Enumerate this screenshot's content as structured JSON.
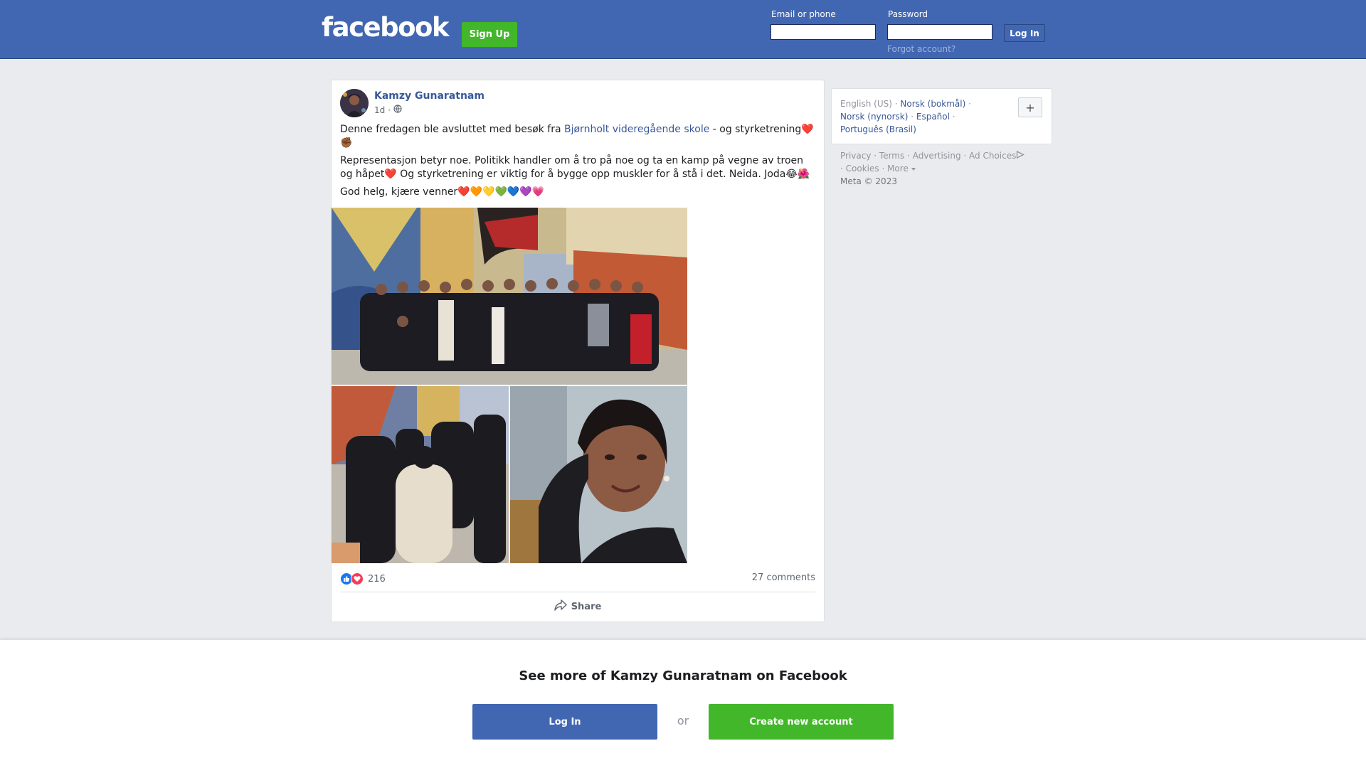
{
  "header": {
    "logo": "facebook",
    "signup_label": "Sign Up",
    "email_label": "Email or phone",
    "password_label": "Password",
    "login_label": "Log In",
    "forgot_label": "Forgot account?"
  },
  "post": {
    "author": "Kamzy Gunaratnam",
    "time": "1d",
    "separator": "·",
    "text": {
      "p1_before": "Denne fredagen ble avsluttet med besøk fra ",
      "p1_link": "Bjørnholt videregående skole",
      "p1_after": " - og styrketrening",
      "p1_emoji": "❤️✊🏾",
      "p2": "Representasjon betyr noe. Politikk handler om å tro på noe og ta en kamp på vegne av troen og håpet❤️ Og styrketrening er viktig for å bygge opp muskler for å stå i det. Neida. Joda😂🌺",
      "p3": "God helg, kjære venner❤️🧡💛💚💙💜💗"
    },
    "reaction_count": "216",
    "comments": "27 comments",
    "share_label": "Share"
  },
  "sidebar": {
    "languages": [
      "English (US)",
      "Norsk (bokmål)",
      "Norsk (nynorsk)",
      "Español",
      "Português (Brasil)"
    ],
    "add_label": "+",
    "footer": [
      "Privacy",
      "Terms",
      "Advertising",
      "Ad Choices",
      "Cookies",
      "More"
    ],
    "copyright": "Meta © 2023"
  },
  "banner": {
    "title": "See more of Kamzy Gunaratnam on Facebook",
    "login_label": "Log In",
    "or_label": "or",
    "create_label": "Create new account"
  },
  "colors": {
    "brand_blue": "#4267b2",
    "green": "#42b72a",
    "link": "#385898"
  },
  "icons": [
    "globe-icon",
    "like-reaction-icon",
    "love-reaction-icon",
    "share-icon",
    "ad-choices-icon",
    "caret-down-icon"
  ]
}
